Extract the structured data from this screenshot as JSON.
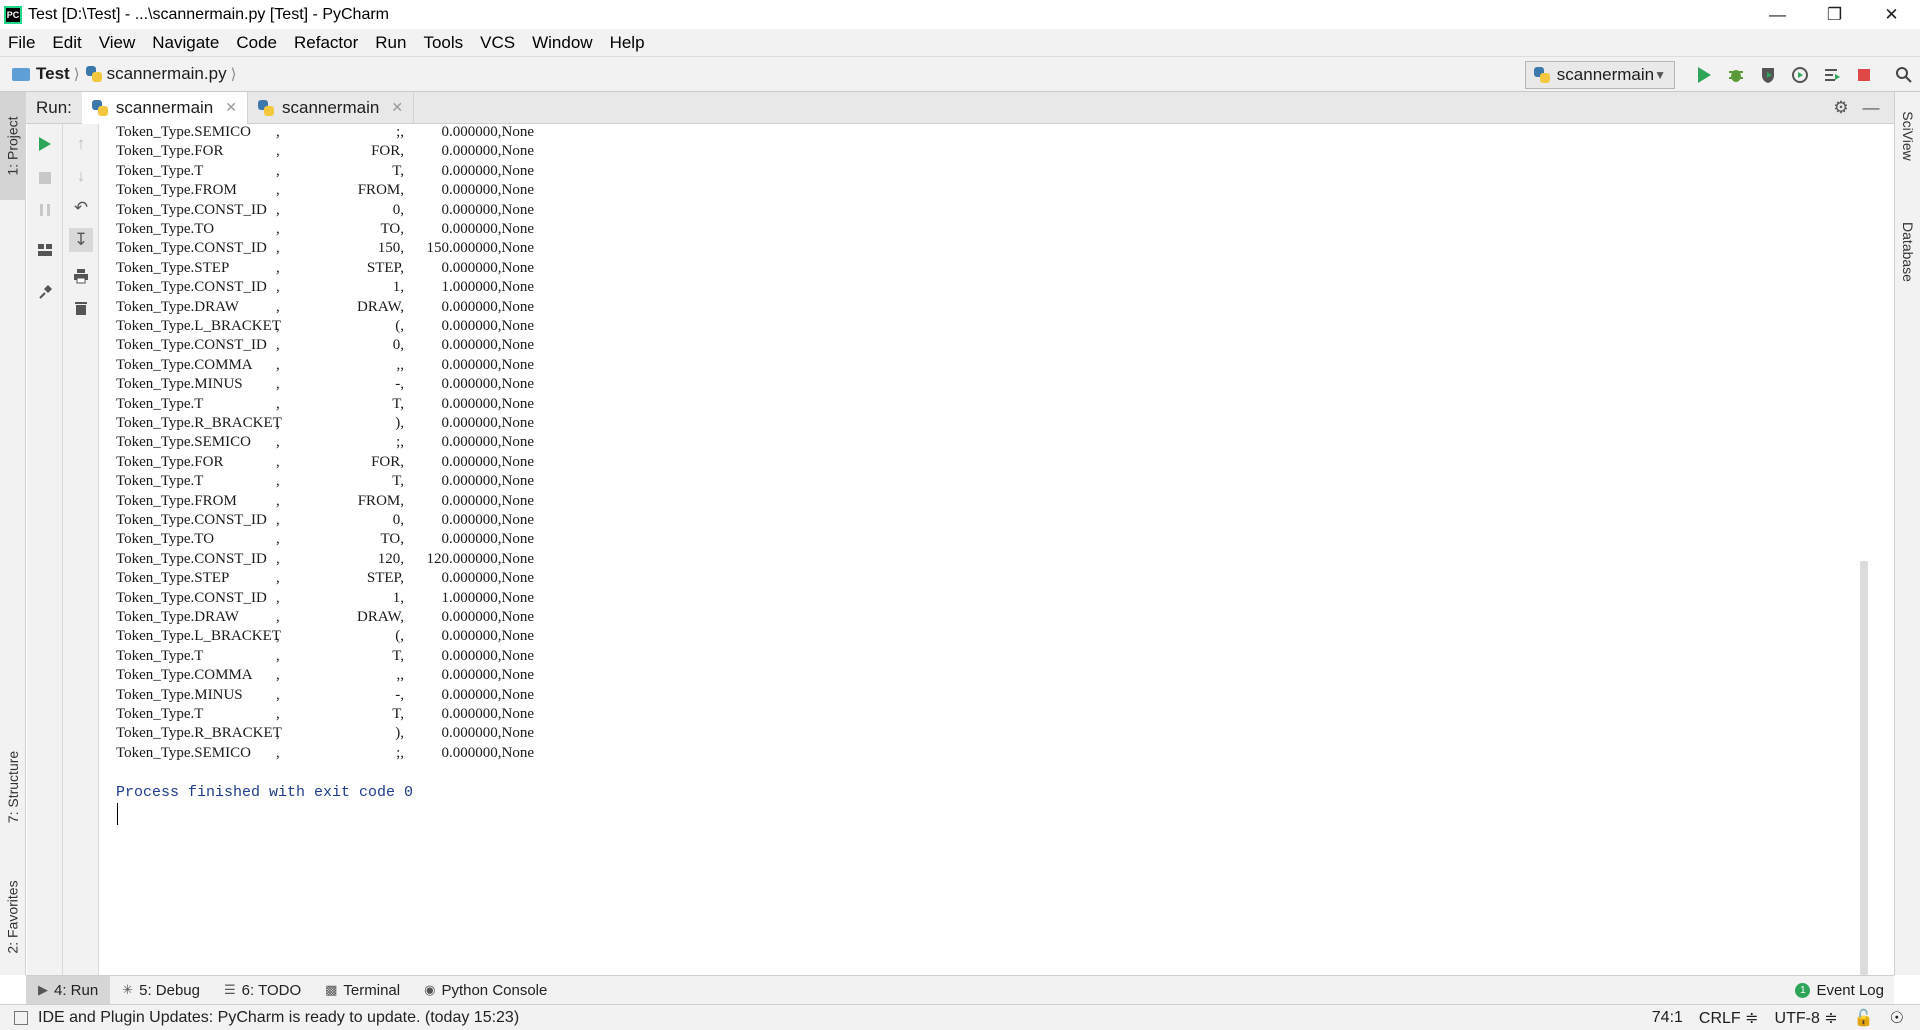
{
  "window": {
    "title": "Test [D:\\Test] - ...\\scannermain.py [Test] - PyCharm",
    "app_icon": "PC"
  },
  "menu": [
    "File",
    "Edit",
    "View",
    "Navigate",
    "Code",
    "Refactor",
    "Run",
    "Tools",
    "VCS",
    "Window",
    "Help"
  ],
  "breadcrumb": {
    "project": "Test",
    "file": "scannermain.py"
  },
  "run_config": {
    "name": "scannermain"
  },
  "left_tabs": {
    "project": "1: Project",
    "structure": "7: Structure",
    "favorites": "2: Favorites"
  },
  "right_tabs": {
    "sciview": "SciView",
    "database": "Database"
  },
  "run_panel": {
    "label": "Run:",
    "tabs": [
      {
        "label": "scannermain"
      },
      {
        "label": "scannermain"
      }
    ]
  },
  "console": {
    "rows": [
      {
        "type": "Token_Type.SEMICO",
        "comma": ",",
        "lexeme": ";,",
        "value": "0.000000,None"
      },
      {
        "type": "Token_Type.FOR",
        "comma": ",",
        "lexeme": "FOR,",
        "value": "0.000000,None"
      },
      {
        "type": "Token_Type.T",
        "comma": ",",
        "lexeme": "T,",
        "value": "0.000000,None"
      },
      {
        "type": "Token_Type.FROM",
        "comma": ",",
        "lexeme": "FROM,",
        "value": "0.000000,None"
      },
      {
        "type": "Token_Type.CONST_ID",
        "comma": ",",
        "lexeme": "0,",
        "value": "0.000000,None"
      },
      {
        "type": "Token_Type.TO",
        "comma": ",",
        "lexeme": "TO,",
        "value": "0.000000,None"
      },
      {
        "type": "Token_Type.CONST_ID",
        "comma": ",",
        "lexeme": "150,",
        "value": "150.000000,None"
      },
      {
        "type": "Token_Type.STEP",
        "comma": ",",
        "lexeme": "STEP,",
        "value": "0.000000,None"
      },
      {
        "type": "Token_Type.CONST_ID",
        "comma": ",",
        "lexeme": "1,",
        "value": "1.000000,None"
      },
      {
        "type": "Token_Type.DRAW",
        "comma": ",",
        "lexeme": "DRAW,",
        "value": "0.000000,None"
      },
      {
        "type": "Token_Type.L_BRACKET",
        "comma": ",",
        "lexeme": "(,",
        "value": "0.000000,None"
      },
      {
        "type": "Token_Type.CONST_ID",
        "comma": ",",
        "lexeme": "0,",
        "value": "0.000000,None"
      },
      {
        "type": "Token_Type.COMMA",
        "comma": ",",
        "lexeme": ",,",
        "value": "0.000000,None"
      },
      {
        "type": "Token_Type.MINUS",
        "comma": ",",
        "lexeme": "-,",
        "value": "0.000000,None"
      },
      {
        "type": "Token_Type.T",
        "comma": ",",
        "lexeme": "T,",
        "value": "0.000000,None"
      },
      {
        "type": "Token_Type.R_BRACKET",
        "comma": ",",
        "lexeme": "),",
        "value": "0.000000,None"
      },
      {
        "type": "Token_Type.SEMICO",
        "comma": ",",
        "lexeme": ";,",
        "value": "0.000000,None"
      },
      {
        "type": "Token_Type.FOR",
        "comma": ",",
        "lexeme": "FOR,",
        "value": "0.000000,None"
      },
      {
        "type": "Token_Type.T",
        "comma": ",",
        "lexeme": "T,",
        "value": "0.000000,None"
      },
      {
        "type": "Token_Type.FROM",
        "comma": ",",
        "lexeme": "FROM,",
        "value": "0.000000,None"
      },
      {
        "type": "Token_Type.CONST_ID",
        "comma": ",",
        "lexeme": "0,",
        "value": "0.000000,None"
      },
      {
        "type": "Token_Type.TO",
        "comma": ",",
        "lexeme": "TO,",
        "value": "0.000000,None"
      },
      {
        "type": "Token_Type.CONST_ID",
        "comma": ",",
        "lexeme": "120,",
        "value": "120.000000,None"
      },
      {
        "type": "Token_Type.STEP",
        "comma": ",",
        "lexeme": "STEP,",
        "value": "0.000000,None"
      },
      {
        "type": "Token_Type.CONST_ID",
        "comma": ",",
        "lexeme": "1,",
        "value": "1.000000,None"
      },
      {
        "type": "Token_Type.DRAW",
        "comma": ",",
        "lexeme": "DRAW,",
        "value": "0.000000,None"
      },
      {
        "type": "Token_Type.L_BRACKET",
        "comma": ",",
        "lexeme": "(,",
        "value": "0.000000,None"
      },
      {
        "type": "Token_Type.T",
        "comma": ",",
        "lexeme": "T,",
        "value": "0.000000,None"
      },
      {
        "type": "Token_Type.COMMA",
        "comma": ",",
        "lexeme": ",,",
        "value": "0.000000,None"
      },
      {
        "type": "Token_Type.MINUS",
        "comma": ",",
        "lexeme": "-,",
        "value": "0.000000,None"
      },
      {
        "type": "Token_Type.T",
        "comma": ",",
        "lexeme": "T,",
        "value": "0.000000,None"
      },
      {
        "type": "Token_Type.R_BRACKET",
        "comma": ",",
        "lexeme": "),",
        "value": "0.000000,None"
      },
      {
        "type": "Token_Type.SEMICO",
        "comma": ",",
        "lexeme": ";,",
        "value": "0.000000,None"
      }
    ],
    "process_message": "Process finished with exit code 0"
  },
  "bottom_tabs": [
    {
      "label": "4: Run",
      "icon": "run-icon"
    },
    {
      "label": "5: Debug",
      "icon": "debug-icon"
    },
    {
      "label": "6: TODO",
      "icon": "todo-icon"
    },
    {
      "label": "Terminal",
      "icon": "terminal-icon"
    },
    {
      "label": "Python Console",
      "icon": "python-console-icon"
    }
  ],
  "event_log": {
    "label": "Event Log",
    "count": "1"
  },
  "status": {
    "message": "IDE and Plugin Updates: PyCharm is ready to update. (today 15:23)",
    "position": "74:1",
    "line_sep": "CRLF ≑",
    "encoding": "UTF-8 ≑"
  },
  "colors": {
    "accent_green": "#2fa55a",
    "stop_red": "#e04848",
    "process_blue": "#1f3c8a"
  }
}
